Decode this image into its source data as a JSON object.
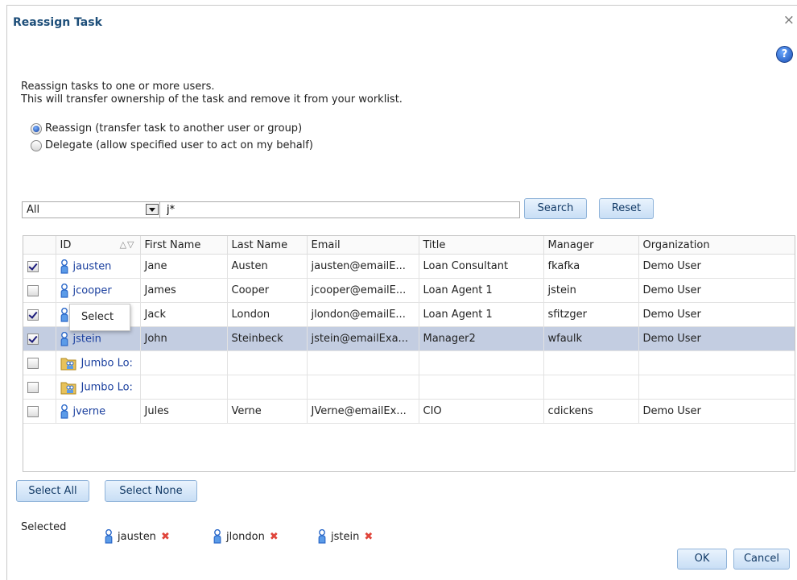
{
  "dialog": {
    "title": "Reassign Task",
    "close_glyph": "×",
    "help_glyph": "?",
    "desc_line1": "Reassign tasks to one or more users.",
    "desc_line2": "This will transfer ownership of the task and remove it from your worklist.",
    "radio_reassign": "Reassign (transfer task to another user or group)",
    "radio_delegate": "Delegate (allow specified user to act on my behalf)",
    "filter_value": "All",
    "search_value": "j*",
    "search_label": "Search",
    "reset_label": "Reset",
    "tooltip": "Select",
    "select_all_label": "Select All",
    "select_none_label": "Select None",
    "selected_label": "Selected",
    "ok_label": "OK",
    "cancel_label": "Cancel"
  },
  "columns": [
    "ID",
    "First Name",
    "Last Name",
    "Email",
    "Title",
    "Manager",
    "Organization"
  ],
  "rows": [
    {
      "checked": true,
      "icon": "user-icon",
      "id": "jausten",
      "first": "Jane",
      "last": "Austen",
      "email": "jausten@emailE...",
      "title": "Loan Consultant",
      "manager": "fkafka",
      "org": "Demo User"
    },
    {
      "checked": false,
      "icon": "user-icon",
      "id": "jcooper",
      "first": "James",
      "last": "Cooper",
      "email": "jcooper@emailE...",
      "title": "Loan Agent 1",
      "manager": "jstein",
      "org": "Demo User"
    },
    {
      "checked": true,
      "icon": "user-icon",
      "id": "",
      "first": "Jack",
      "last": "London",
      "email": "jlondon@emailE...",
      "title": "Loan Agent 1",
      "manager": "sfitzger",
      "org": "Demo User"
    },
    {
      "checked": true,
      "icon": "user-icon",
      "id": "jstein",
      "first": "John",
      "last": "Steinbeck",
      "email": "jstein@emailExa...",
      "title": "Manager2",
      "manager": "wfaulk",
      "org": "Demo User"
    },
    {
      "checked": false,
      "icon": "group-icon",
      "id": "Jumbo Lo:",
      "first": "",
      "last": "",
      "email": "",
      "title": "",
      "manager": "",
      "org": ""
    },
    {
      "checked": false,
      "icon": "group-icon",
      "id": "Jumbo Lo:",
      "first": "",
      "last": "",
      "email": "",
      "title": "",
      "manager": "",
      "org": ""
    },
    {
      "checked": false,
      "icon": "user-icon",
      "id": "jverne",
      "first": "Jules",
      "last": "Verne",
      "email": "JVerne@emailEx...",
      "title": "CIO",
      "manager": "cdickens",
      "org": "Demo User"
    }
  ],
  "selected_index": 3,
  "selected_users": [
    "jausten",
    "jlondon",
    "jstein"
  ],
  "colors": {
    "accent": "#1d4e79",
    "row_selected": "#c3cde1",
    "remove": "#e0453b"
  }
}
